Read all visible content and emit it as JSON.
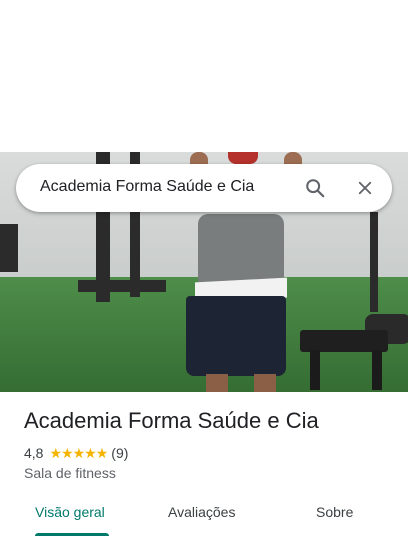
{
  "search": {
    "query": "Academia Forma Saúde e Cia",
    "search_icon": "search-icon",
    "close_icon": "close-icon"
  },
  "place": {
    "name": "Academia Forma Saúde e Cia",
    "rating": "4,8",
    "rating_value": 4.8,
    "stars": [
      "★",
      "★",
      "★",
      "★",
      "★"
    ],
    "review_count": "(9)",
    "category": "Sala de fitness"
  },
  "tabs": [
    {
      "label": "Visão geral",
      "active": true
    },
    {
      "label": "Avaliações",
      "active": false
    },
    {
      "label": "Sobre",
      "active": false
    }
  ],
  "colors": {
    "accent": "#00796b",
    "star": "#f4b400",
    "text_primary": "#202124",
    "text_secondary": "#5f6368"
  }
}
